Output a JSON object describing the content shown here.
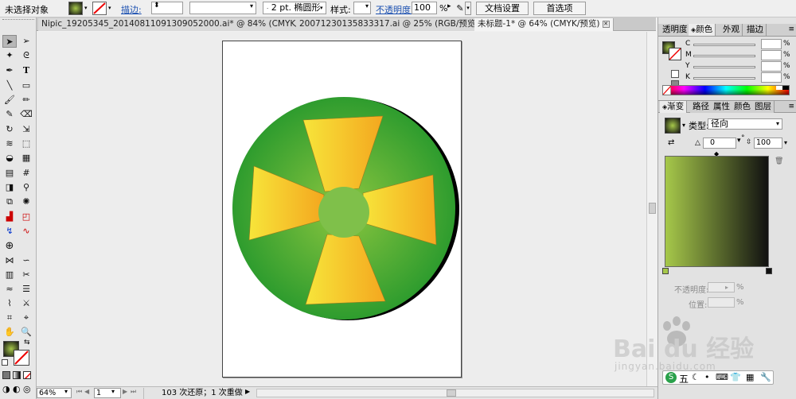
{
  "control_bar": {
    "selection_status": "未选择对象",
    "stroke_label": "描边:",
    "stroke_weight_value": "",
    "brush_value": "2 pt. 椭圆形",
    "style_label": "样式:",
    "opacity_label": "不透明度:",
    "opacity_value": "100",
    "opacity_unit": "%",
    "document_setup_button": "文档设置",
    "preferences_button": "首选项"
  },
  "tabs": [
    {
      "label": "Nipic_19205345_20140811091309052000.ai* @ 84% (CMYK/预览)"
    },
    {
      "label": "20071230135833317.ai @ 25% (RGB/预览)"
    },
    {
      "label": "未标题-1* @ 64% (CMYK/预览)"
    }
  ],
  "color_panel": {
    "tabs": [
      "透明度",
      "颜色",
      "外观",
      "描边"
    ],
    "channels": [
      "C",
      "M",
      "Y",
      "K"
    ],
    "channel_unit": "%"
  },
  "gradient_panel": {
    "tabs": [
      "渐变",
      "路径",
      "属性",
      "颜色",
      "图层"
    ],
    "type_label": "类型:",
    "type_value": "径向",
    "angle_value": "0",
    "angle_unit": "°",
    "aspect_value": "100",
    "aspect_unit": "%",
    "opacity_label": "不透明度:",
    "position_label": "位置:",
    "percent": "%",
    "start_color": "#a6c84a",
    "end_color": "#111111"
  },
  "status_bar": {
    "zoom_value": "64%",
    "artboard_value": "1",
    "history_text": "103 次还原；1 次重做"
  },
  "artwork": {
    "disc_inner": "#8cc63f",
    "disc_outer": "#2e9c2e",
    "blade_light": "#f7e53a",
    "blade_dark": "#f4a71f"
  },
  "watermark": {
    "logo_text": "Bai du 经验",
    "url_text": "jingyan.baidu.com"
  },
  "ime_bar": {
    "label": "五"
  }
}
